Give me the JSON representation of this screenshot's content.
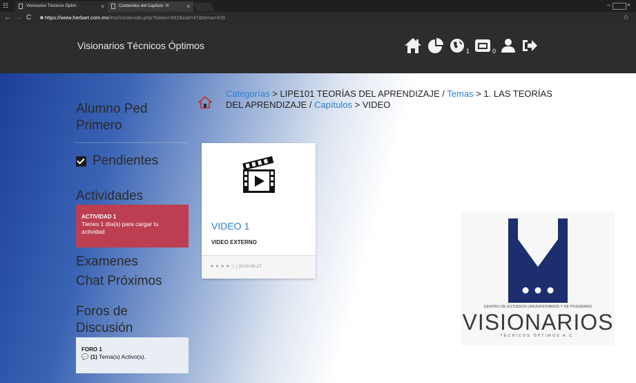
{
  "browser": {
    "tabs": [
      {
        "label": "Visionarios Técnicos Óptim"
      },
      {
        "label": "Contenidos del Capítulo: Vi"
      }
    ],
    "url_host": "https://www.herbart.com.mx",
    "url_path": "/lms/contenido.php?token=692&cat=47&tema=439"
  },
  "header": {
    "brand": "Visionarios Técnicos Óptimos",
    "icons": [
      {
        "name": "home-icon"
      },
      {
        "name": "pie-chart-icon"
      },
      {
        "name": "globe-icon",
        "count": "1"
      },
      {
        "name": "message-icon",
        "count": "0"
      },
      {
        "name": "user-icon"
      },
      {
        "name": "sign-out-icon"
      }
    ]
  },
  "sidebar": {
    "student_name": "Alumno Ped Primero",
    "pendientes": "Pendientes",
    "actividades": "Actividades",
    "activity": {
      "title": "ACTIVIDAD 1",
      "text": "Tienes 1 día(s) para cargar tu actividad"
    },
    "examenes": "Examenes",
    "chat": "Chat Próximos",
    "foros": "Foros de Discusión",
    "forum": {
      "title": "FORO 1",
      "count": "(1)",
      "text": "Tema(s) Activo(s)."
    }
  },
  "breadcrumb": {
    "categorias": "Categorías",
    "sep1": ">",
    "course": "LIPE101 TEORÍAS DEL APRENDIZAJE /",
    "temas": "Temas",
    "sep2": ">",
    "topic": "1. LAS TEORÍAS DEL APRENDIZAJE /",
    "capitulos": "Capítulos",
    "sep3": ">",
    "current": "VIDEO"
  },
  "card": {
    "title": "VIDEO 1",
    "subtitle": "VIDEO EXTERNO",
    "stars": "★ ★ ★ ★ ☆",
    "date": "| 2018-06-27"
  },
  "logo": {
    "small": "CENTRO DE ESTUDIOS UNIVERSITARIOS Y DE POSGRADO",
    "big": "VISIONARIOS",
    "sub": "TÉCNICOS ÓPTIMOS A.C."
  },
  "colors": {
    "header_bg": "#2d2d2d",
    "accent_blue": "#2a7fd6",
    "activity_red": "#bb3f51",
    "logo_navy": "#1c2e6e"
  }
}
